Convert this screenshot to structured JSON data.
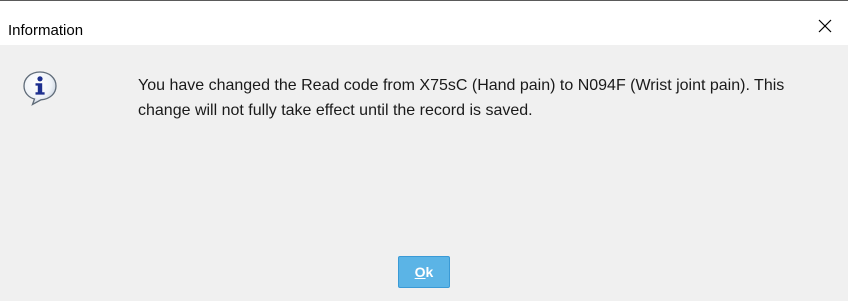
{
  "window": {
    "title": "Information",
    "close_icon": "close-icon"
  },
  "message": {
    "icon": "info-icon",
    "text": "You have changed the Read code from X75sC (Hand pain) to N094F (Wrist joint pain). This change will not fully take effect until the record is saved."
  },
  "buttons": {
    "ok_mnemonic": "O",
    "ok_rest": "k"
  },
  "colors": {
    "ok_button_bg": "#5bb4e6",
    "body_bg": "#f0f0f0",
    "titlebar_bg": "#ffffff"
  }
}
